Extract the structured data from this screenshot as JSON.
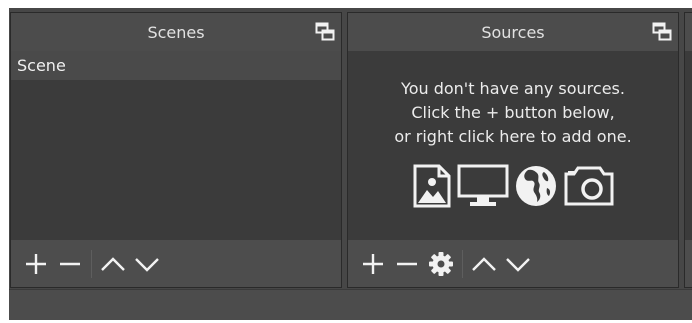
{
  "scenes": {
    "title": "Scenes",
    "items": [
      {
        "label": "Scene",
        "selected": true
      }
    ],
    "toolbar": [
      "add-icon",
      "remove-icon",
      "move-up-icon",
      "move-down-icon"
    ]
  },
  "sources": {
    "title": "Sources",
    "empty_message": {
      "line1": "You don't have any sources.",
      "line2": "Click the + button below,",
      "line3": "or right click here to add one."
    },
    "source_type_icons": [
      "image-icon",
      "display-icon",
      "globe-icon",
      "camera-icon"
    ],
    "toolbar": [
      "add-icon",
      "remove-icon",
      "settings-gear-icon",
      "move-up-icon",
      "move-down-icon"
    ]
  },
  "colors": {
    "panel_bg": "#3b3b3b",
    "header_bg": "#4c4c4c",
    "selected_item_bg": "#4a4a4a",
    "text": "#e6e6e6",
    "icon": "#f2f2f2"
  }
}
